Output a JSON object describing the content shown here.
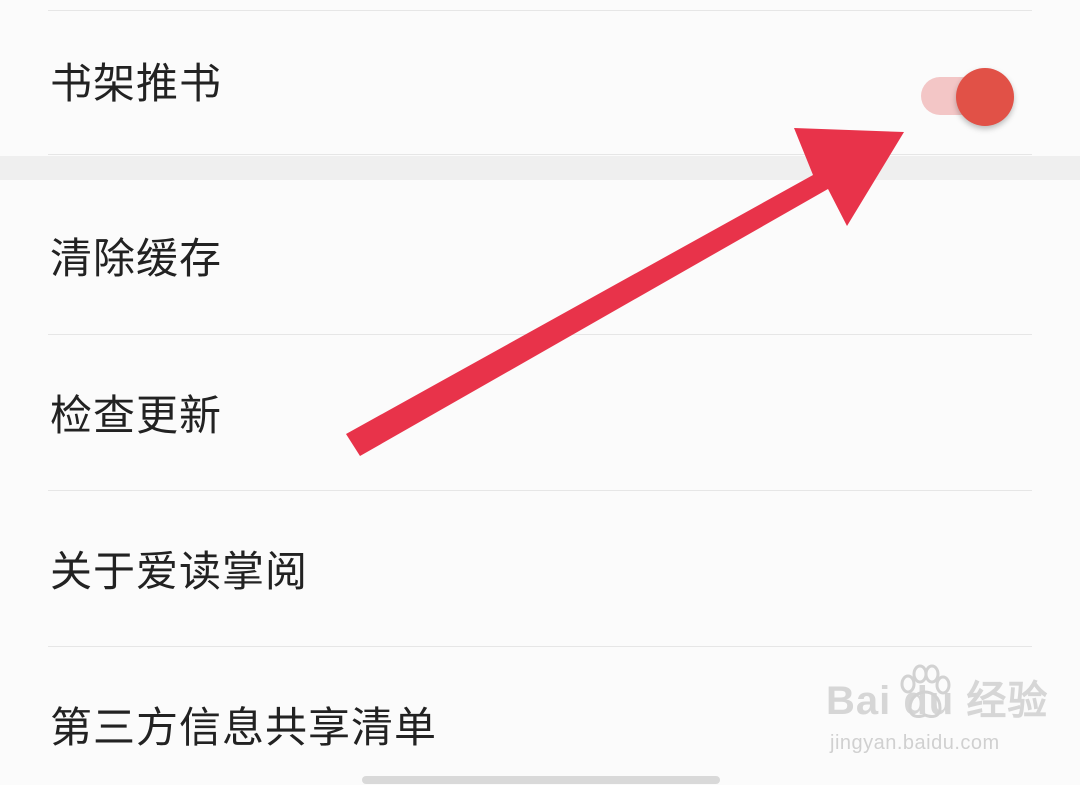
{
  "settings": {
    "items": [
      {
        "label": "书架推书",
        "toggle": true
      },
      {
        "label": "清除缓存"
      },
      {
        "label": "检查更新"
      },
      {
        "label": "关于爱读掌阅"
      },
      {
        "label": "第三方信息共享清单"
      }
    ]
  },
  "toggle": {
    "on": true,
    "track_color": "#f3c6c6",
    "thumb_color": "#e15147"
  },
  "annotation": {
    "arrow_color": "#e8334a"
  },
  "watermark": {
    "logo_text": "Bai  du 经验",
    "url": "jingyan.baidu.com"
  }
}
